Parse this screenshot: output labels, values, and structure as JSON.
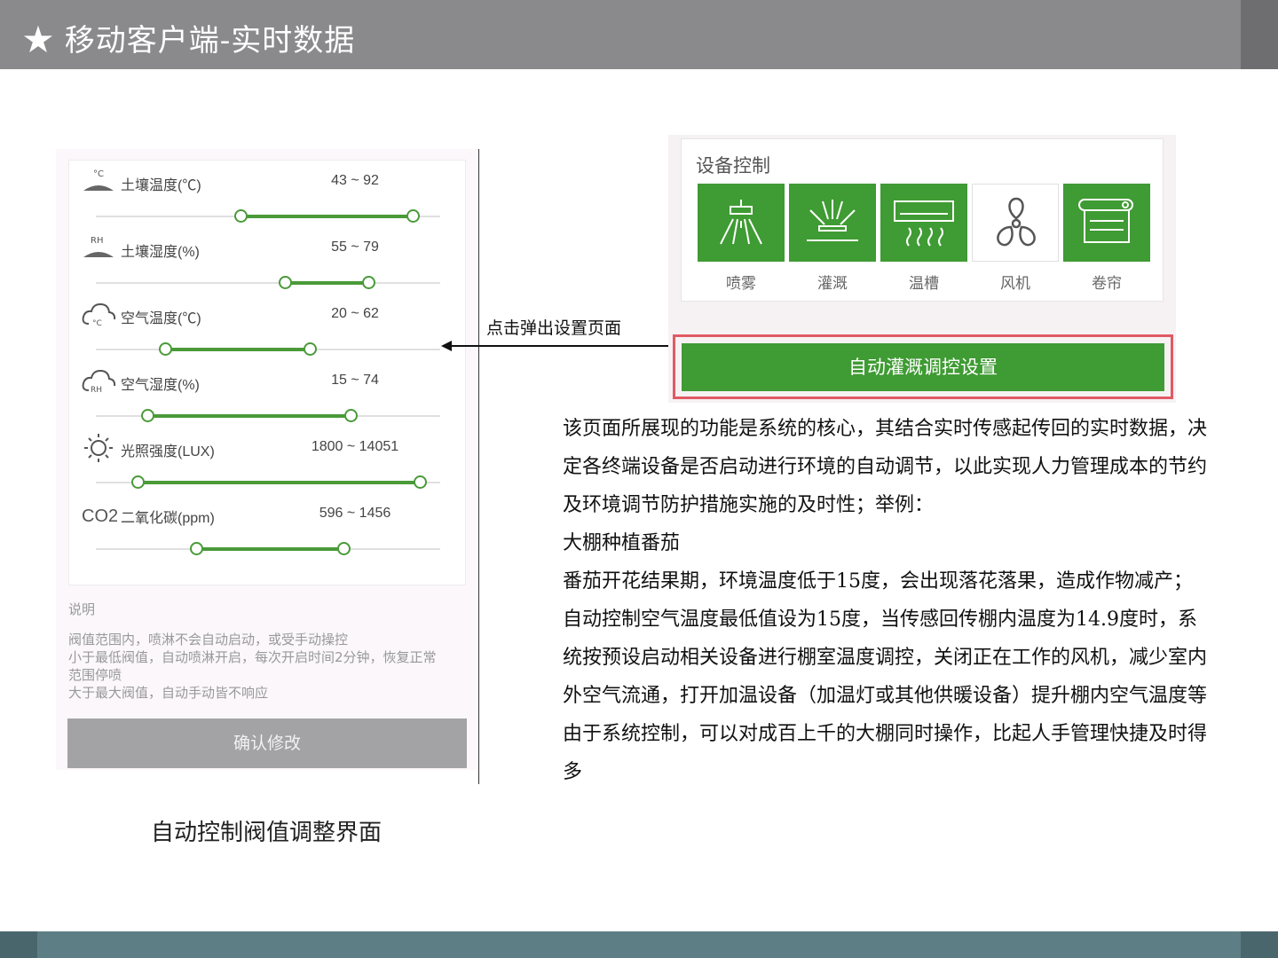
{
  "header": {
    "title": "★ 移动客户端-实时数据"
  },
  "thresholds": {
    "items": [
      {
        "icon": "soil-temperature-icon",
        "icon_text": "°C",
        "label": "土壤温度(℃)",
        "range": "43 ~ 92",
        "min": 0.42,
        "max": 0.92
      },
      {
        "icon": "soil-humidity-icon",
        "icon_text": "RH",
        "label": "土壤湿度(%)",
        "range": "55 ~ 79",
        "min": 0.55,
        "max": 0.79
      },
      {
        "icon": "air-temperature-icon",
        "icon_text": "°C",
        "label": "空气温度(℃)",
        "range": "20 ~ 62",
        "min": 0.2,
        "max": 0.62
      },
      {
        "icon": "air-humidity-icon",
        "icon_text": "RH",
        "label": "空气湿度(%)",
        "range": "15 ~ 74",
        "min": 0.15,
        "max": 0.74
      },
      {
        "icon": "sun-icon",
        "icon_text": "",
        "label": "光照强度(LUX)",
        "range": "1800 ~ 14051",
        "min": 0.12,
        "max": 0.94
      },
      {
        "icon": "co2-icon",
        "icon_text": "CO2",
        "label": "二氧化碳(ppm)",
        "range": "596 ~ 1456",
        "min": 0.29,
        "max": 0.72
      }
    ],
    "notes_title": "说明",
    "notes": [
      "阀值范围内，喷淋不会自动启动，或受手动操控",
      "小于最低阀值，自动喷淋开启，每次开启时间2分钟，恢复正常",
      "范围停喷",
      "大于最大阀值，自动手动皆不响应"
    ],
    "confirm_label": "确认修改",
    "caption": "自动控制阀值调整界面"
  },
  "arrow_label": "点击弹出设置页面",
  "device_control": {
    "title": "设备控制",
    "devices": [
      {
        "label": "喷雾",
        "icon": "spray-icon",
        "on": true
      },
      {
        "label": "灌溉",
        "icon": "irrigation-icon",
        "on": true
      },
      {
        "label": "温槽",
        "icon": "heater-icon",
        "on": true
      },
      {
        "label": "风机",
        "icon": "fan-icon",
        "on": false
      },
      {
        "label": "卷帘",
        "icon": "roller-blind-icon",
        "on": true
      }
    ],
    "colors": {
      "on": "#3f9b33",
      "off": "#ffffff",
      "highlight": "#e05a64"
    },
    "auto_button_label": "自动灌溉调控设置"
  },
  "description": [
    "该页面所展现的功能是系统的核心，其结合实时传感起传回的实时数据，决定各终端设备是否启动进行环境的自动调节，以此实现人力管理成本的节约及环境调节防护措施实施的及时性；举例：",
    "大棚种植番茄",
    "番茄开花结果期，环境温度低于15度，会出现落花落果，造成作物减产；",
    "自动控制空气温度最低值设为15度，当传感回传棚内温度为14.9度时，系统按预设启动相关设备进行棚室温度调控，关闭正在工作的风机，减少室内外空气流通，打开加温设备（加温灯或其他供暖设备）提升棚内空气温度等",
    "由于系统控制，可以对成百上千的大棚同时操作，比起人手管理快捷及时得多"
  ]
}
